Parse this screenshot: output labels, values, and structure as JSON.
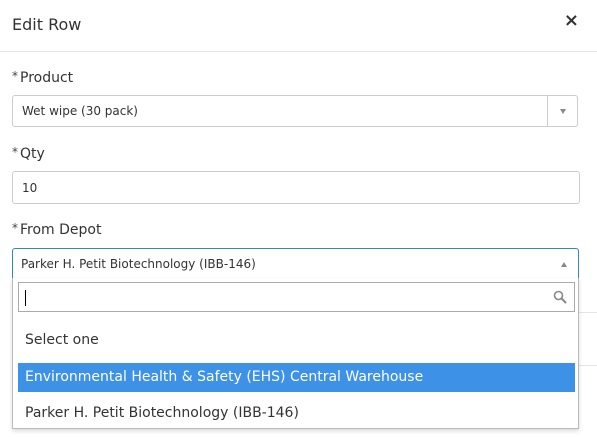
{
  "modal": {
    "title": "Edit Row",
    "close_symbol": "×"
  },
  "form": {
    "product": {
      "required_mark": "*",
      "label": "Product",
      "value": "Wet wipe (30 pack)"
    },
    "qty": {
      "required_mark": "*",
      "label": "Qty",
      "value": "10"
    },
    "from_depot": {
      "required_mark": "*",
      "label": "From Depot",
      "value": "Parker H. Petit Biotechnology (IBB-146)",
      "search_value": "",
      "options": [
        {
          "label": "Select one",
          "highlighted": false
        },
        {
          "label": "Environmental Health & Safety (EHS) Central Warehouse",
          "highlighted": true
        },
        {
          "label": "Parker H. Petit Biotechnology (IBB-146)",
          "highlighted": false
        }
      ]
    }
  },
  "colors": {
    "highlight": "#3d91e6",
    "focus_border": "#2d86d4"
  },
  "icons": {
    "close": "close-icon",
    "product_dropdown": "chevron-down-icon",
    "depot_dropdown": "chevron-up-icon",
    "search": "search-icon"
  }
}
